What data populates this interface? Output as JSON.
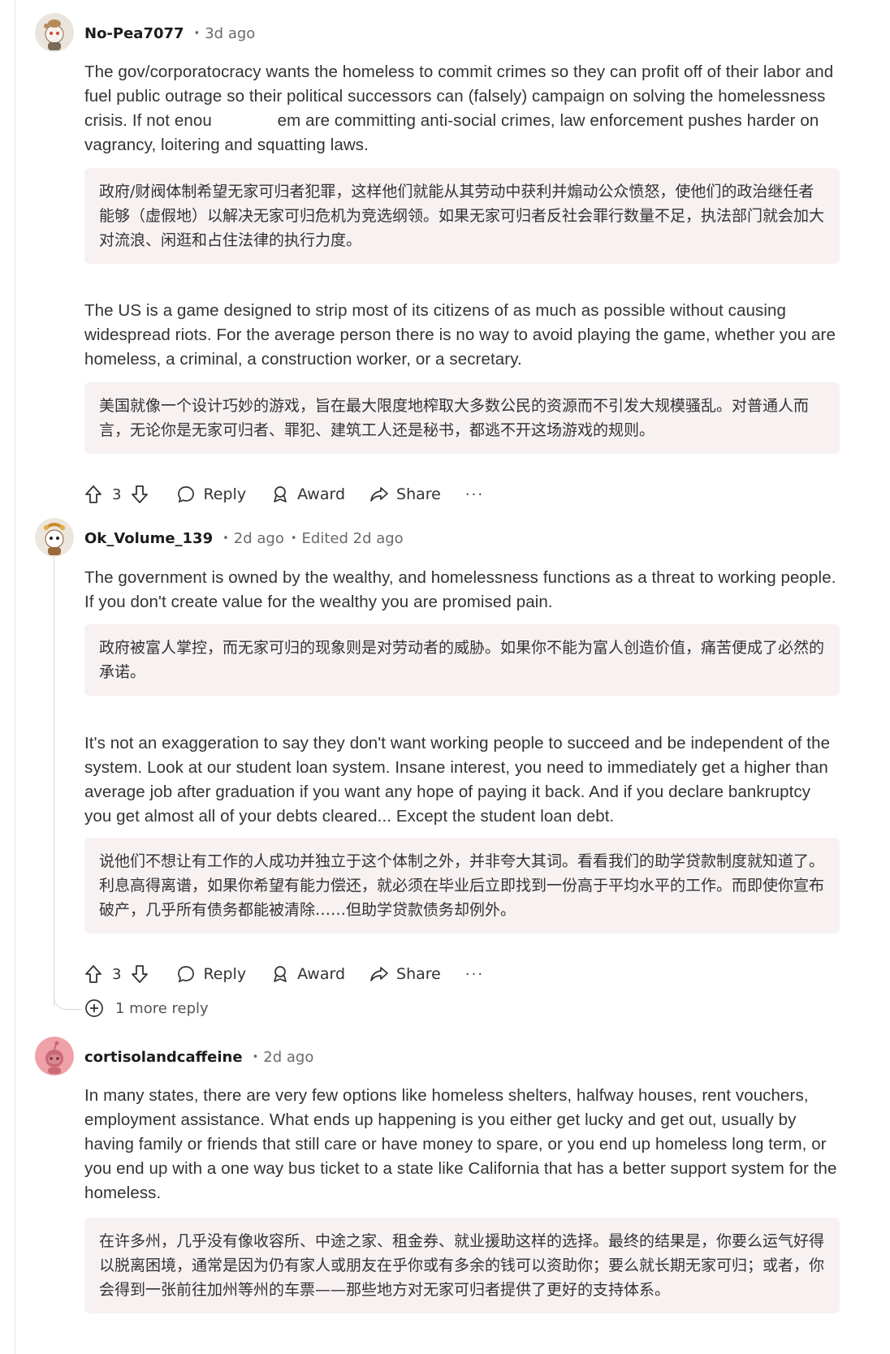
{
  "comments": [
    {
      "username": "No-Pea7077",
      "time": "3d ago",
      "edited": "",
      "paras": [
        {
          "text_a": "The gov/corporatocracy wants the homeless to commit crimes so they can profit off of their labor and fuel public outrage so their political successors can (falsely) campaign on solving the homelessness crisis. If not enou",
          "text_b": " em are committing anti-social crimes, law enforcement pushes harder on vagrancy, loitering and squatting laws.",
          "translation": "政府/财阀体制希望无家可归者犯罪，这样他们就能从其劳动中获利并煽动公众愤怒，使他们的政治继任者能够（虚假地）以解决无家可归危机为竞选纲领。如果无家可归者反社会罪行数量不足，执法部门就会加大对流浪、闲逛和占住法律的执行力度。"
        },
        {
          "text": "The US is a game designed to strip most of its citizens of as much as possible without causing widespread riots. For the average person there is no way to avoid playing the game, whether you are homeless, a criminal, a construction worker, or a secretary.",
          "translation": "美国就像一个设计巧妙的游戏，旨在最大限度地榨取大多数公民的资源而不引发大规模骚乱。对普通人而言，无论你是无家可归者、罪犯、建筑工人还是秘书，都逃不开这场游戏的规则。"
        }
      ],
      "votes": "3"
    },
    {
      "username": "Ok_Volume_139",
      "time": "2d ago",
      "edited": "Edited 2d ago",
      "paras": [
        {
          "text": "The government is owned by the wealthy, and homelessness functions as a threat to working people. If you don't create value for the wealthy you are promised pain.",
          "translation": "政府被富人掌控，而无家可归的现象则是对劳动者的威胁。如果你不能为富人创造价值，痛苦便成了必然的承诺。"
        },
        {
          "text": "It's not an exaggeration to say they don't want working people to succeed and be independent of the system. Look at our student loan system. Insane interest, you need to immediately get a higher than average job after graduation if you want any hope of paying it back. And if you declare bankruptcy you get almost all of your debts cleared... Except the student loan debt.",
          "translation": "说他们不想让有工作的人成功并独立于这个体制之外，并非夸大其词。看看我们的助学贷款制度就知道了。利息高得离谱，如果你希望有能力偿还，就必须在毕业后立即找到一份高于平均水平的工作。而即使你宣布破产，几乎所有债务都能被清除……但助学贷款债务却例外。"
        }
      ],
      "votes": "3",
      "more_replies": "1 more reply"
    },
    {
      "username": "cortisolandcaffeine",
      "time": "2d ago",
      "edited": "",
      "paras": [
        {
          "text": "In many states, there are very few options like homeless shelters, halfway houses, rent vouchers, employment assistance. What ends up happening is you either get lucky and get out, usually by having family or friends that still care or have money to spare, or you end up homeless long term, or you end up with a one way bus ticket to a state like California that has a better support system for the homeless.",
          "translation": "在许多州，几乎没有像收容所、中途之家、租金券、就业援助这样的选择。最终的结果是，你要么运气好得以脱离困境，通常是因为仍有家人或朋友在乎你或有多余的钱可以资助你；要么就长期无家可归；或者，你会得到一张前往加州等州的车票——那些地方对无家可归者提供了更好的支持体系。"
        }
      ]
    }
  ],
  "actions": {
    "reply": "Reply",
    "award": "Award",
    "share": "Share",
    "more": "···"
  },
  "colors": {
    "translation_bg": "#f8f1f1",
    "muted": "#6b6b6b",
    "avatar3_bg": "#f0a0a8"
  }
}
